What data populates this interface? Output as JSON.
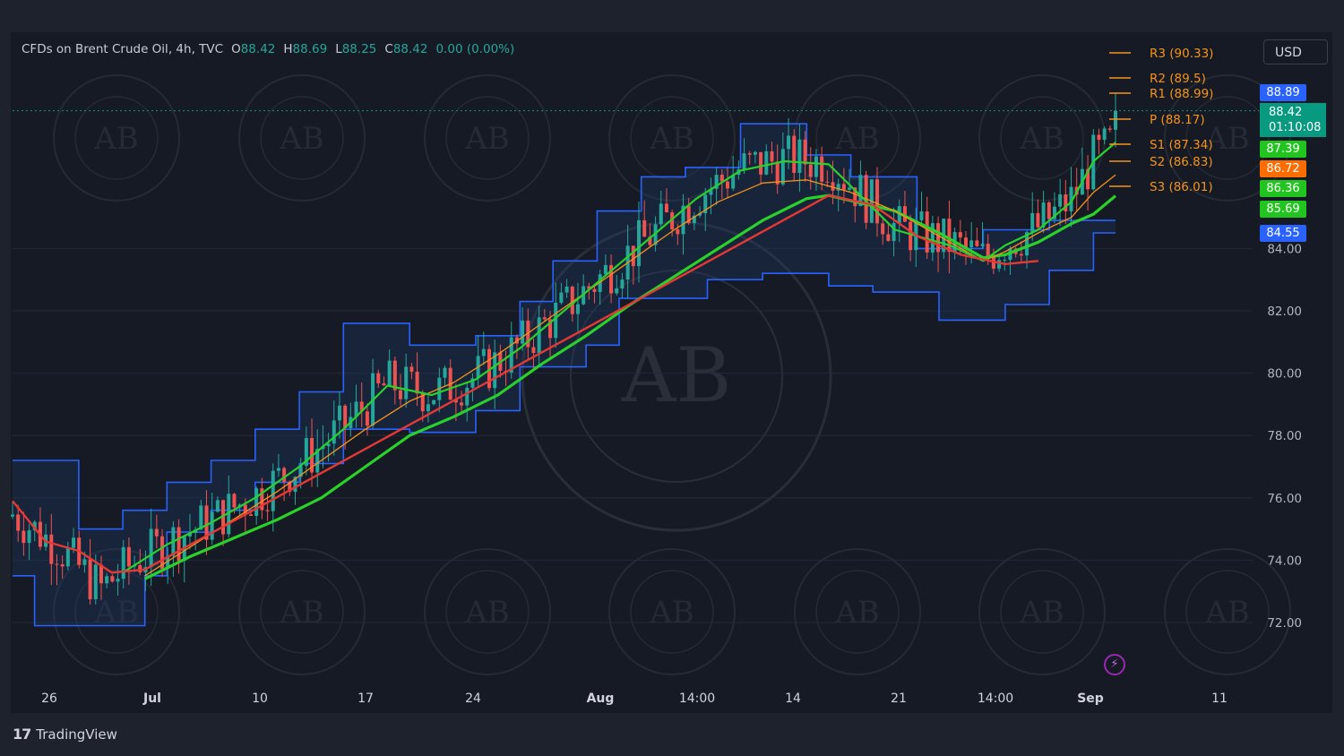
{
  "header": {
    "symbol": "CFDs on Brent Crude Oil",
    "interval": "4h",
    "source": "TVC",
    "o_label": "O",
    "o_value": "88.42",
    "h_label": "H",
    "h_value": "88.69",
    "l_label": "L",
    "l_value": "88.25",
    "c_label": "C",
    "c_value": "88.42",
    "change": "0.00",
    "change_pct": "(0.00%)"
  },
  "currency": "USD",
  "footer": {
    "logo": "17",
    "brand": "TradingView"
  },
  "colors": {
    "background": "#151a25",
    "up": "#26a69a",
    "down": "#ef5350",
    "channel_line": "#2962ff",
    "pivot": "#f7931a",
    "ema_green": "#2bd12b",
    "ema_red": "#e53935"
  },
  "icons": {
    "replay": "lightning-bolt-icon",
    "logo": "tradingview-logo-icon"
  },
  "price_tags": [
    {
      "value": "88.89",
      "color": "#2962ff"
    },
    {
      "value": "87.39",
      "color": "#22c51f"
    },
    {
      "value": "86.72",
      "color": "#ff6d00"
    },
    {
      "value": "86.36",
      "color": "#22c51f"
    },
    {
      "value": "85.69",
      "color": "#22c51f"
    },
    {
      "value": "84.55",
      "color": "#2962ff"
    }
  ],
  "last_price": {
    "value": "88.42",
    "countdown": "01:10:08"
  },
  "chart_data": {
    "type": "candlestick",
    "instrument": "Brent Crude Oil CFD",
    "timeframe": "4h",
    "y_ticks": [
      84,
      82,
      80,
      78,
      76,
      74,
      72
    ],
    "ylim": [
      70.5,
      91.5
    ],
    "x_ticks": [
      "26",
      "Jul",
      "10",
      "17",
      "24",
      "Aug",
      "14:00",
      "14",
      "21",
      "14:00",
      "Sep",
      "11"
    ],
    "pivots": [
      {
        "label": "R3",
        "value": 90.33
      },
      {
        "label": "R2",
        "value": 89.5
      },
      {
        "label": "R1",
        "value": 88.99
      },
      {
        "label": "P",
        "value": 88.17
      },
      {
        "label": "S1",
        "value": 87.34
      },
      {
        "label": "S2",
        "value": 86.83
      },
      {
        "label": "S3",
        "value": 86.01
      }
    ],
    "channel_upper": [
      [
        0,
        77.2
      ],
      [
        6,
        77.2
      ],
      [
        6,
        75.0
      ],
      [
        10,
        75.0
      ],
      [
        10,
        75.6
      ],
      [
        14,
        75.6
      ],
      [
        14,
        76.5
      ],
      [
        18,
        76.5
      ],
      [
        18,
        77.2
      ],
      [
        22,
        77.2
      ],
      [
        22,
        78.2
      ],
      [
        26,
        78.2
      ],
      [
        26,
        79.4
      ],
      [
        30,
        79.4
      ],
      [
        30,
        81.6
      ],
      [
        36,
        81.6
      ],
      [
        36,
        80.9
      ],
      [
        42,
        80.9
      ],
      [
        42,
        81.2
      ],
      [
        46,
        81.2
      ],
      [
        46,
        82.3
      ],
      [
        49,
        82.3
      ],
      [
        49,
        83.6
      ],
      [
        53,
        83.6
      ],
      [
        53,
        85.2
      ],
      [
        57,
        85.2
      ],
      [
        57,
        86.3
      ],
      [
        61,
        86.3
      ],
      [
        61,
        86.6
      ],
      [
        66,
        86.6
      ],
      [
        66,
        88.0
      ],
      [
        72,
        88.0
      ],
      [
        72,
        87.0
      ],
      [
        76,
        87.0
      ],
      [
        76,
        86.3
      ],
      [
        82,
        86.3
      ],
      [
        82,
        84.0
      ],
      [
        88,
        84.0
      ],
      [
        88,
        84.6
      ],
      [
        94,
        84.6
      ],
      [
        94,
        84.9
      ],
      [
        100,
        84.9
      ]
    ],
    "channel_lower": [
      [
        0,
        73.5
      ],
      [
        2,
        73.5
      ],
      [
        2,
        71.9
      ],
      [
        8,
        71.9
      ],
      [
        8,
        71.9
      ],
      [
        12,
        71.9
      ],
      [
        12,
        73.5
      ],
      [
        14,
        73.5
      ],
      [
        14,
        74.9
      ],
      [
        18,
        74.9
      ],
      [
        18,
        75.6
      ],
      [
        22,
        75.6
      ],
      [
        22,
        76.5
      ],
      [
        26,
        76.5
      ],
      [
        26,
        77.1
      ],
      [
        30,
        77.1
      ],
      [
        30,
        78.2
      ],
      [
        36,
        78.2
      ],
      [
        36,
        78.1
      ],
      [
        42,
        78.1
      ],
      [
        42,
        78.8
      ],
      [
        46,
        78.8
      ],
      [
        46,
        80.2
      ],
      [
        52,
        80.2
      ],
      [
        52,
        80.9
      ],
      [
        55,
        80.9
      ],
      [
        55,
        82.4
      ],
      [
        58,
        82.4
      ],
      [
        58,
        82.4
      ],
      [
        63,
        82.4
      ],
      [
        63,
        83.0
      ],
      [
        68,
        83.0
      ],
      [
        68,
        83.2
      ],
      [
        74,
        83.2
      ],
      [
        74,
        82.8
      ],
      [
        78,
        82.8
      ],
      [
        78,
        82.6
      ],
      [
        84,
        82.6
      ],
      [
        84,
        81.7
      ],
      [
        90,
        81.7
      ],
      [
        90,
        82.2
      ],
      [
        94,
        82.2
      ],
      [
        94,
        83.3
      ],
      [
        98,
        83.3
      ],
      [
        98,
        84.5
      ],
      [
        100,
        84.5
      ]
    ],
    "ema_fast_green": [
      [
        10,
        73.6
      ],
      [
        14,
        74.5
      ],
      [
        18,
        75.2
      ],
      [
        22,
        76.0
      ],
      [
        26,
        77.0
      ],
      [
        30,
        78.2
      ],
      [
        34,
        79.6
      ],
      [
        38,
        79.3
      ],
      [
        42,
        79.8
      ],
      [
        46,
        80.8
      ],
      [
        50,
        82.0
      ],
      [
        54,
        83.2
      ],
      [
        58,
        84.4
      ],
      [
        62,
        85.6
      ],
      [
        66,
        86.5
      ],
      [
        70,
        86.8
      ],
      [
        74,
        86.7
      ],
      [
        80,
        84.6
      ],
      [
        85,
        84.1
      ],
      [
        88,
        83.6
      ],
      [
        90,
        84.1
      ],
      [
        93,
        84.6
      ],
      [
        96,
        85.5
      ],
      [
        98,
        86.8
      ],
      [
        100,
        87.4
      ]
    ],
    "ema_mid_green": [
      [
        12,
        73.5
      ],
      [
        16,
        74.4
      ],
      [
        20,
        75.3
      ],
      [
        24,
        76.2
      ],
      [
        28,
        77.2
      ],
      [
        32,
        78.2
      ],
      [
        36,
        79.1
      ],
      [
        40,
        79.7
      ],
      [
        44,
        80.6
      ],
      [
        48,
        81.6
      ],
      [
        52,
        82.6
      ],
      [
        56,
        83.6
      ],
      [
        60,
        84.6
      ],
      [
        64,
        85.5
      ],
      [
        68,
        86.1
      ],
      [
        72,
        86.2
      ],
      [
        76,
        85.8
      ],
      [
        80,
        85.2
      ],
      [
        84,
        84.4
      ],
      [
        88,
        83.6
      ],
      [
        90,
        83.9
      ],
      [
        93,
        84.5
      ],
      [
        96,
        85.0
      ],
      [
        98,
        85.8
      ],
      [
        100,
        86.36
      ]
    ],
    "ema_slow_green": [
      [
        12,
        73.4
      ],
      [
        16,
        74.1
      ],
      [
        20,
        74.7
      ],
      [
        24,
        75.3
      ],
      [
        28,
        76.0
      ],
      [
        32,
        77.0
      ],
      [
        36,
        78.0
      ],
      [
        40,
        78.6
      ],
      [
        44,
        79.3
      ],
      [
        48,
        80.3
      ],
      [
        52,
        81.2
      ],
      [
        56,
        82.2
      ],
      [
        60,
        83.1
      ],
      [
        64,
        84.0
      ],
      [
        68,
        84.9
      ],
      [
        72,
        85.6
      ],
      [
        74,
        85.7
      ],
      [
        80,
        85.2
      ],
      [
        84,
        84.5
      ],
      [
        88,
        83.7
      ],
      [
        90,
        83.8
      ],
      [
        93,
        84.2
      ],
      [
        96,
        84.8
      ],
      [
        98,
        85.1
      ],
      [
        100,
        85.69
      ]
    ],
    "ema_red": [
      [
        0,
        75.9
      ],
      [
        3,
        74.6
      ],
      [
        6,
        74.3
      ],
      [
        9,
        73.6
      ],
      [
        12,
        73.7
      ],
      [
        74,
        85.7
      ],
      [
        78,
        85.4
      ],
      [
        82,
        84.4
      ],
      [
        86,
        83.8
      ],
      [
        90,
        83.5
      ],
      [
        93,
        83.6
      ]
    ],
    "candle_summary": {
      "first_close": 75.4,
      "low": 71.9,
      "high": 88.89,
      "last_close": 88.42
    }
  }
}
